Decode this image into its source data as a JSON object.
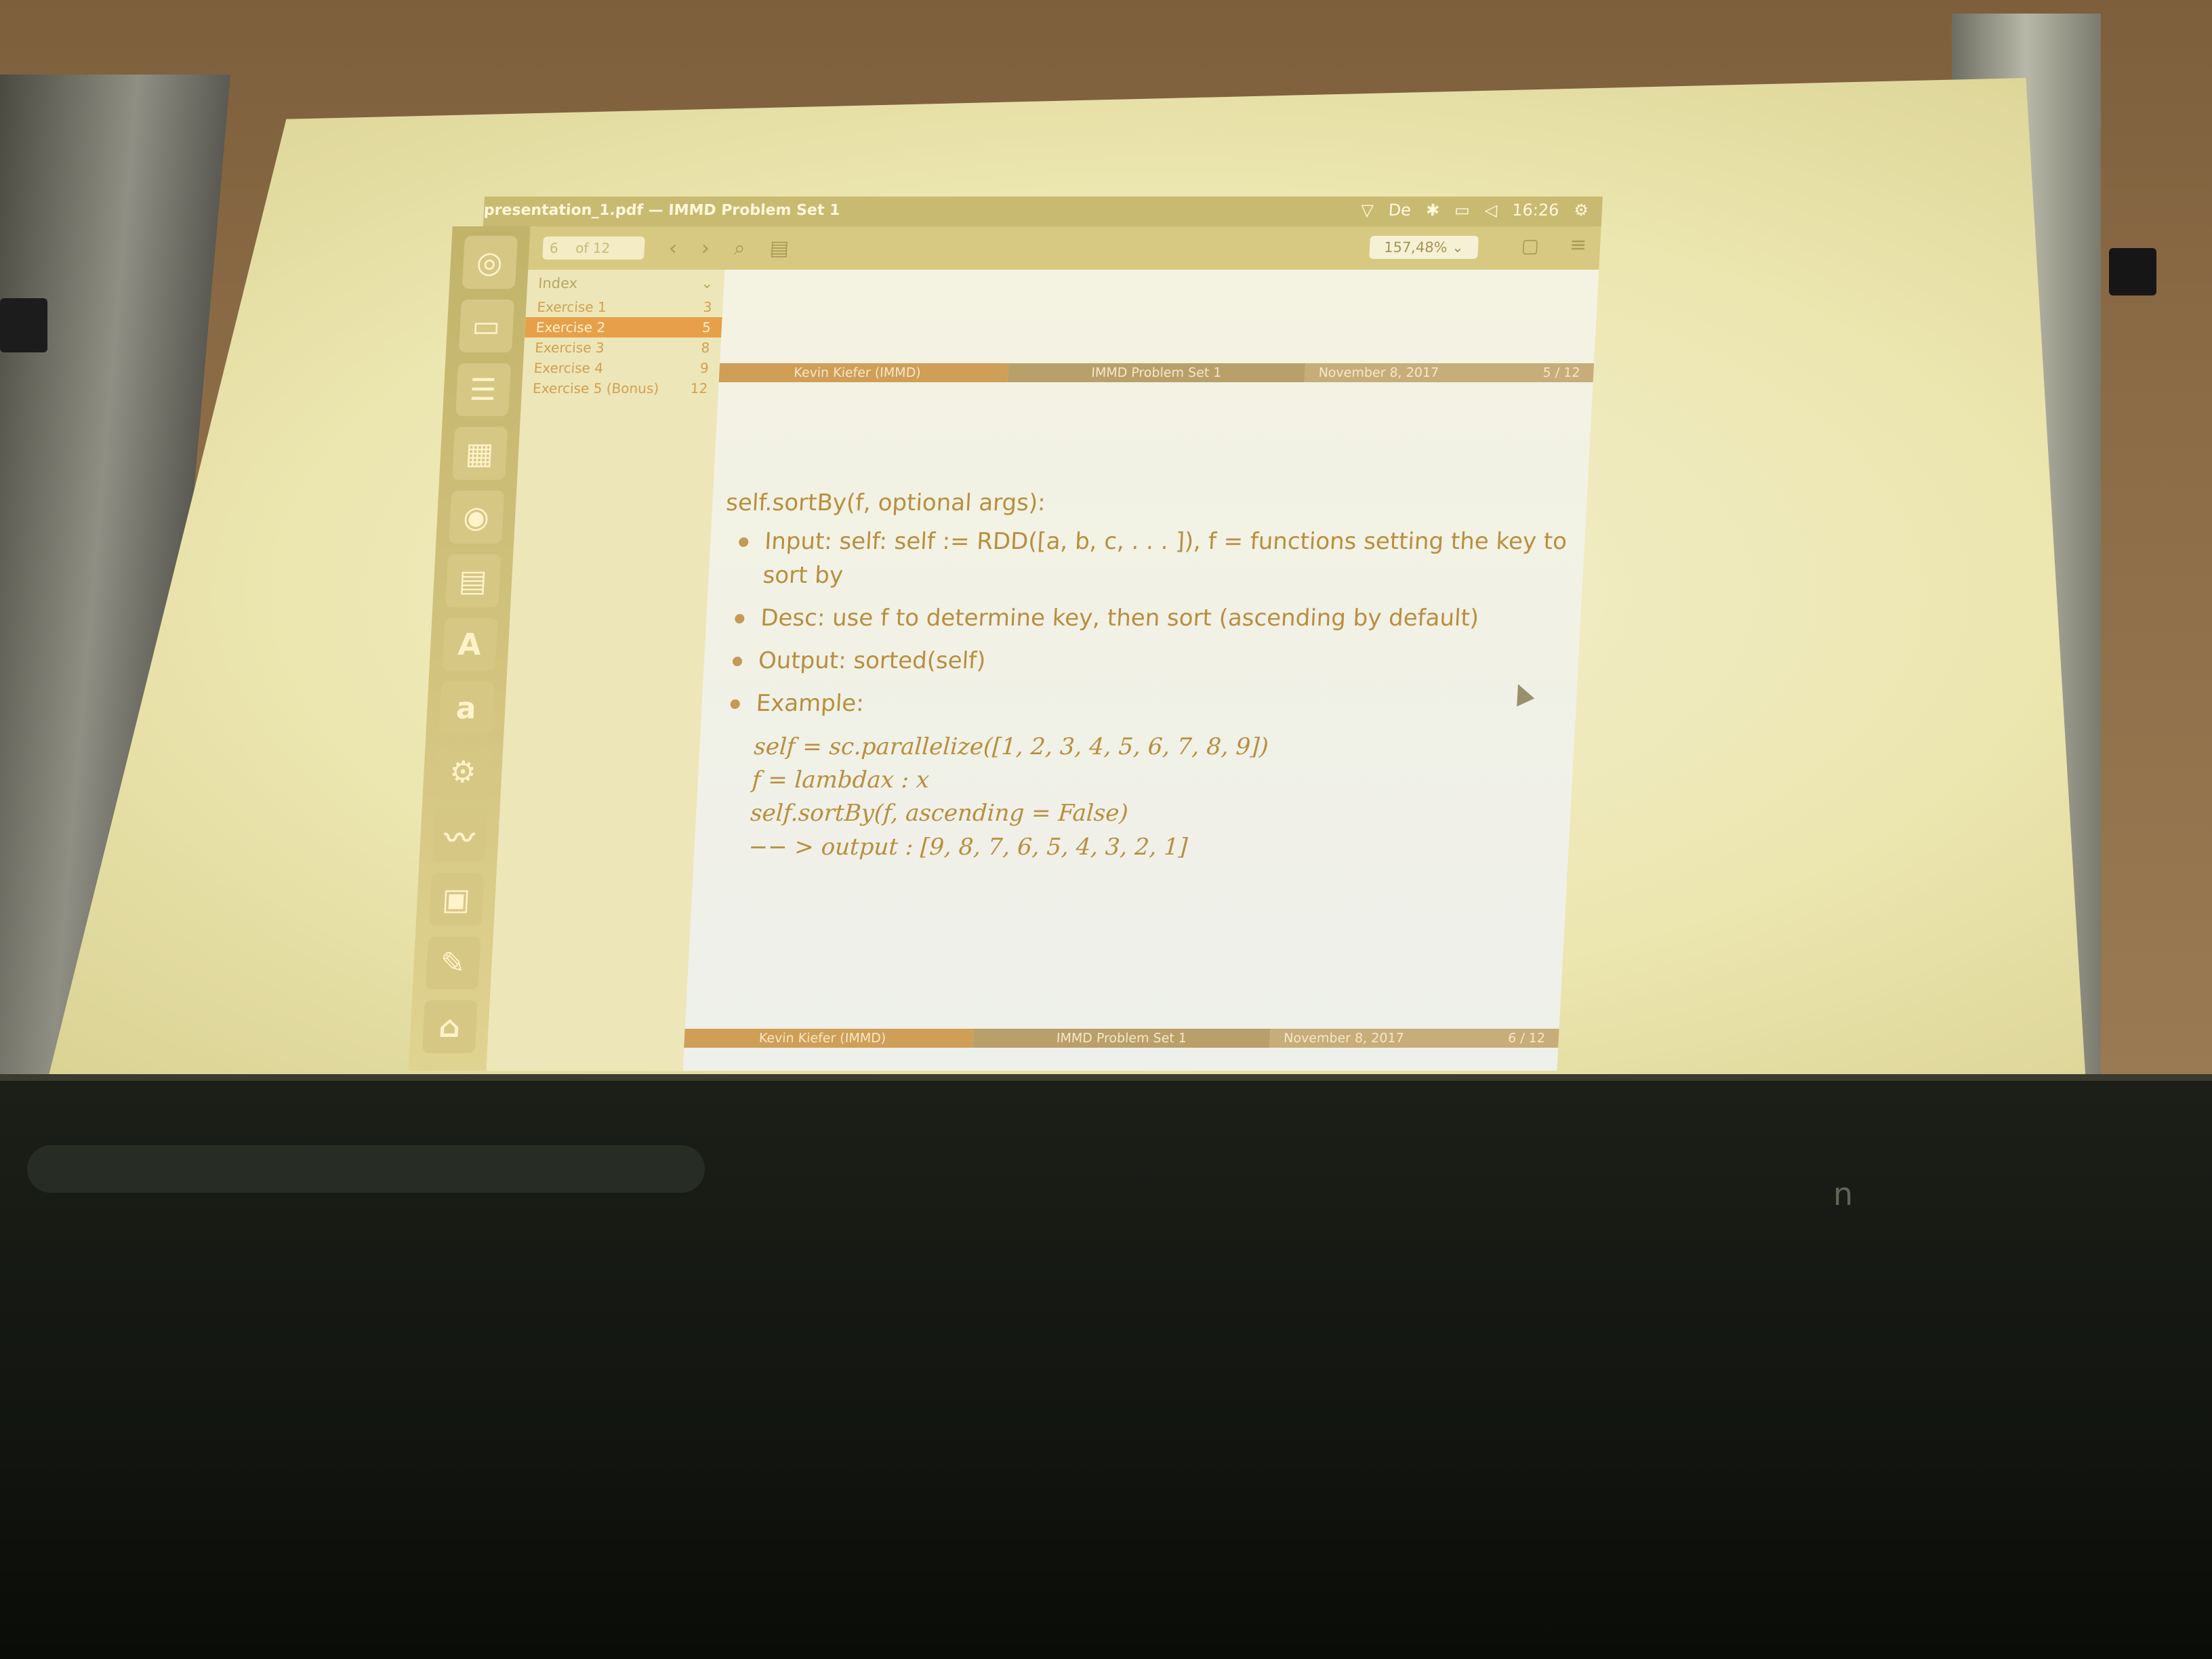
{
  "window": {
    "title": "presentation_1.pdf — IMMD Problem Set 1",
    "tray": {
      "keyboard": "De",
      "time": "16:26"
    }
  },
  "launcher": [
    {
      "icon": "ubuntu-logo-icon",
      "glyph": "◎"
    },
    {
      "icon": "files-icon",
      "glyph": "▭"
    },
    {
      "icon": "writer-icon",
      "glyph": "☰"
    },
    {
      "icon": "calc-icon",
      "glyph": "▦"
    },
    {
      "icon": "firefox-icon",
      "glyph": "◉"
    },
    {
      "icon": "impress-icon",
      "glyph": "▤"
    },
    {
      "icon": "software-center-icon",
      "glyph": "A"
    },
    {
      "icon": "amazon-icon",
      "glyph": "a"
    },
    {
      "icon": "settings-icon",
      "glyph": "⚙"
    },
    {
      "icon": "system-monitor-icon",
      "glyph": "〰"
    },
    {
      "icon": "image-viewer-icon",
      "glyph": "▣"
    },
    {
      "icon": "text-editor-icon",
      "glyph": "✎"
    },
    {
      "icon": "trash-icon",
      "glyph": "⌂"
    }
  ],
  "toolbar": {
    "page_current": "6",
    "page_total": "of 12",
    "zoom": "157,48%"
  },
  "sidebar": {
    "header": "Index",
    "items": [
      {
        "label": "Exercise 1",
        "page": "3"
      },
      {
        "label": "Exercise 2",
        "page": "5"
      },
      {
        "label": "Exercise 3",
        "page": "8"
      },
      {
        "label": "Exercise 4",
        "page": "9"
      },
      {
        "label": "Exercise 5 (Bonus)",
        "page": "12"
      }
    ]
  },
  "slide": {
    "footer_prev": {
      "author": "Kevin Kiefer  (IMMD)",
      "title": "IMMD Problem Set 1",
      "date": "November 8, 2017",
      "page": "5 / 12"
    },
    "footer_curr": {
      "author": "Kevin Kiefer  (IMMD)",
      "title": "IMMD Problem Set 1",
      "date": "November 8, 2017",
      "page": "6 / 12"
    },
    "heading": "self.sortBy(f, optional args):",
    "bullets": [
      "Input: self: self := RDD([a, b, c, . . . ]), f = functions setting the key to sort by",
      "Desc: use f to determine key, then sort (ascending by default)",
      "Output: sorted(self)",
      "Example:"
    ],
    "code": [
      "self = sc.parallelize([1, 2, 3, 4, 5, 6, 7, 8, 9])",
      "f = lambdax : x",
      "self.sortBy(f, ascending = False)",
      "−− > output : [9, 8, 7, 6, 5, 4, 3, 2, 1]"
    ]
  },
  "board": {
    "chalk": "n"
  }
}
